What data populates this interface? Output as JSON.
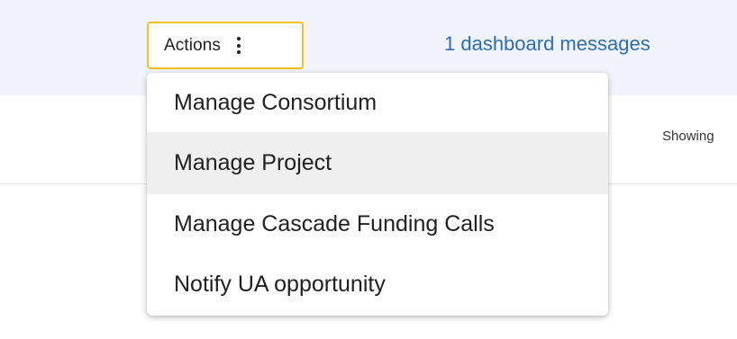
{
  "header": {
    "actions_label": "Actions",
    "actions_icon": "kebab-vertical-icon",
    "dashboard_messages_link": "1 dashboard messages",
    "accent_border_color": "#f3c319",
    "link_color": "#2d6db5"
  },
  "content": {
    "showing_text": "Showing"
  },
  "actions_menu": {
    "items": [
      {
        "label": "Manage Consortium",
        "highlighted": false
      },
      {
        "label": "Manage Project",
        "highlighted": true
      },
      {
        "label": "Manage Cascade Funding Calls",
        "highlighted": false
      },
      {
        "label": "Notify UA opportunity",
        "highlighted": false
      }
    ]
  }
}
